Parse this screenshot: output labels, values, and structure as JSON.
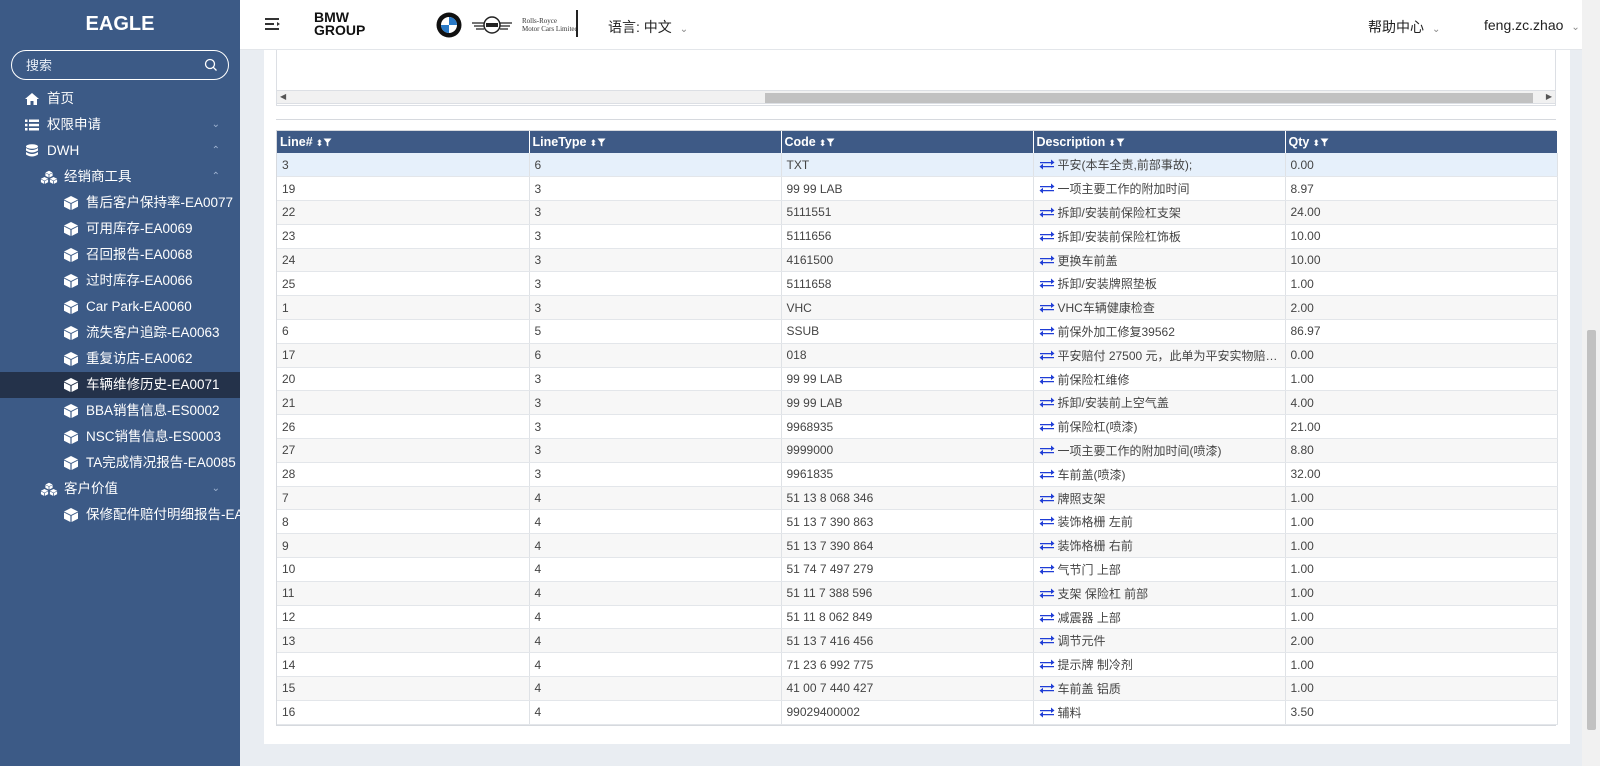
{
  "sidebar": {
    "brand": "EAGLE",
    "search_placeholder": "搜索",
    "items": [
      {
        "label": "首页",
        "icon": "home-icon",
        "level": 0
      },
      {
        "label": "权限申请",
        "icon": "list-icon",
        "level": 0,
        "chevron": "down"
      },
      {
        "label": "DWH",
        "icon": "database-icon",
        "level": 0,
        "chevron": "up"
      },
      {
        "label": "经销商工具",
        "icon": "cubes-icon",
        "level": 1,
        "chevron": "up"
      },
      {
        "label": "售后客户保持率-EA0077",
        "icon": "cube-icon",
        "level": 2
      },
      {
        "label": "可用库存-EA0069",
        "icon": "cube-icon",
        "level": 2
      },
      {
        "label": "召回报告-EA0068",
        "icon": "cube-icon",
        "level": 2
      },
      {
        "label": "过时库存-EA0066",
        "icon": "cube-icon",
        "level": 2
      },
      {
        "label": "Car Park-EA0060",
        "icon": "cube-icon",
        "level": 2
      },
      {
        "label": "流失客户追踪-EA0063",
        "icon": "cube-icon",
        "level": 2
      },
      {
        "label": "重复访店-EA0062",
        "icon": "cube-icon",
        "level": 2
      },
      {
        "label": "车辆维修历史-EA0071",
        "icon": "cube-icon",
        "level": 2,
        "active": true
      },
      {
        "label": "BBA销售信息-ES0002",
        "icon": "cube-icon",
        "level": 2
      },
      {
        "label": "NSC销售信息-ES0003",
        "icon": "cube-icon",
        "level": 2
      },
      {
        "label": "TA完成情况报告-EA0085",
        "icon": "cube-icon",
        "level": 2
      },
      {
        "label": "客户价值",
        "icon": "cubes-icon",
        "level": 1,
        "chevron": "down"
      },
      {
        "label": "保修配件赔付明细报告-EA",
        "icon": "cube-icon",
        "level": 2
      }
    ]
  },
  "header": {
    "bmw_group_line1": "BMW",
    "bmw_group_line2": "GROUP",
    "rr_line1": "Rolls-Royce",
    "rr_line2": "Motor Cars Limited",
    "language": "语言: 中文",
    "help": "帮助中心",
    "user": "feng.zc.zhao"
  },
  "table": {
    "columns": [
      "Line#",
      "LineType",
      "Code",
      "Description",
      "Qty"
    ],
    "rows": [
      [
        "3",
        "6",
        "TXT",
        "平安(本车全责,前部事故);",
        "0.00"
      ],
      [
        "19",
        "3",
        "99 99 LAB",
        "一项主要工作的附加时间",
        "8.97"
      ],
      [
        "22",
        "3",
        "5111551",
        "拆卸/安装前保险杠支架",
        "24.00"
      ],
      [
        "23",
        "3",
        "5111656",
        "拆卸/安装前保险杠饰板",
        "10.00"
      ],
      [
        "24",
        "3",
        "4161500",
        "更换车前盖",
        "10.00"
      ],
      [
        "25",
        "3",
        "5111658",
        "拆卸/安装牌照垫板",
        "1.00"
      ],
      [
        "1",
        "3",
        "VHC",
        "VHC车辆健康检查",
        "2.00"
      ],
      [
        "6",
        "5",
        "SSUB",
        "前保外加工修复39562",
        "86.97"
      ],
      [
        "17",
        "6",
        "018",
        "平安赔付 27500 元，此单为平安实物赔…",
        "0.00"
      ],
      [
        "20",
        "3",
        "99 99 LAB",
        "前保险杠维修",
        "1.00"
      ],
      [
        "21",
        "3",
        "99 99 LAB",
        "拆卸/安装前上空气盖",
        "4.00"
      ],
      [
        "26",
        "3",
        "9968935",
        "前保险杠(喷漆)",
        "21.00"
      ],
      [
        "27",
        "3",
        "9999000",
        "一项主要工作的附加时间(喷漆)",
        "8.80"
      ],
      [
        "28",
        "3",
        "9961835",
        "车前盖(喷漆)",
        "32.00"
      ],
      [
        "7",
        "4",
        "51 13 8 068 346",
        "牌照支架",
        "1.00"
      ],
      [
        "8",
        "4",
        "51 13 7 390 863",
        "装饰格栅 左前",
        "1.00"
      ],
      [
        "9",
        "4",
        "51 13 7 390 864",
        "装饰格栅 右前",
        "1.00"
      ],
      [
        "10",
        "4",
        "51 74 7 497 279",
        "气节门 上部",
        "1.00"
      ],
      [
        "11",
        "4",
        "51 11 7 388 596",
        "支架 保险杠 前部",
        "1.00"
      ],
      [
        "12",
        "4",
        "51 11 8 062 849",
        "减震器 上部",
        "1.00"
      ],
      [
        "13",
        "4",
        "51 13 7 416 456",
        "调节元件",
        "2.00"
      ],
      [
        "14",
        "4",
        "71 23 6 992 775",
        "提示牌 制冷剂",
        "1.00"
      ],
      [
        "15",
        "4",
        "41 00 7 440 427",
        "车前盖 铝质",
        "1.00"
      ],
      [
        "16",
        "4",
        "99029400002",
        "辅料",
        "3.50"
      ]
    ]
  },
  "colors": {
    "sidebar_bg": "#3c5a86",
    "active_item_bg": "#24324a",
    "table_header_bg": "#3e5a86",
    "exchange_icon": "#1f3dd6"
  }
}
